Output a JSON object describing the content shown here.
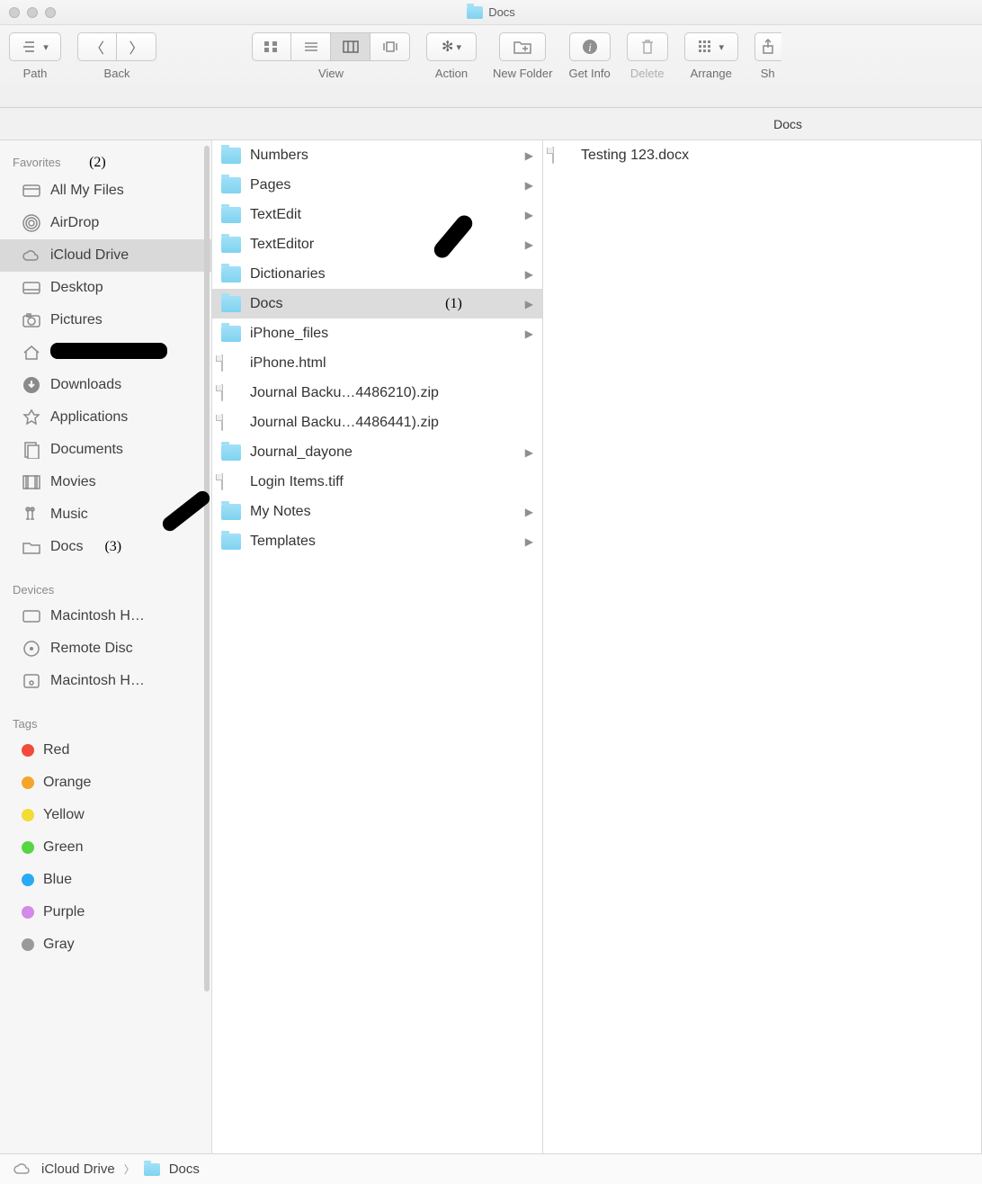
{
  "window": {
    "title": "Docs"
  },
  "toolbar": {
    "path_label": "Path",
    "back_label": "Back",
    "view_label": "View",
    "action_label": "Action",
    "newfolder_label": "New Folder",
    "getinfo_label": "Get Info",
    "delete_label": "Delete",
    "arrange_label": "Arrange",
    "share_label": "Sh"
  },
  "locationbar": {
    "title": "Docs"
  },
  "sidebar": {
    "favorites_heading": "Favorites",
    "devices_heading": "Devices",
    "tags_heading": "Tags",
    "favorites": [
      {
        "label": "All My Files"
      },
      {
        "label": "AirDrop"
      },
      {
        "label": "iCloud Drive",
        "selected": true
      },
      {
        "label": "Desktop"
      },
      {
        "label": "Pictures"
      },
      {
        "label": "",
        "redacted": true
      },
      {
        "label": "Downloads"
      },
      {
        "label": "Applications"
      },
      {
        "label": "Documents"
      },
      {
        "label": "Movies"
      },
      {
        "label": "Music"
      },
      {
        "label": "Docs"
      }
    ],
    "devices": [
      {
        "label": "Macintosh H…"
      },
      {
        "label": "Remote Disc"
      },
      {
        "label": "Macintosh H…"
      }
    ],
    "tags": [
      {
        "label": "Red",
        "color": "#f24b3a"
      },
      {
        "label": "Orange",
        "color": "#f6a52b"
      },
      {
        "label": "Yellow",
        "color": "#f3dc33"
      },
      {
        "label": "Green",
        "color": "#57d544"
      },
      {
        "label": "Blue",
        "color": "#2aa9f5"
      },
      {
        "label": "Purple",
        "color": "#d38ae8"
      },
      {
        "label": "Gray",
        "color": "#9a9a9a"
      }
    ],
    "annotations": {
      "a2": "(2)",
      "a3": "(3)"
    }
  },
  "columns": {
    "col1": [
      {
        "label": "Numbers",
        "type": "appfolder",
        "chev": true
      },
      {
        "label": "Pages",
        "type": "appfolder",
        "chev": true
      },
      {
        "label": "TextEdit",
        "type": "appfolder",
        "chev": true
      },
      {
        "label": "TextEditor",
        "type": "appfolder",
        "chev": true
      },
      {
        "label": "Dictionaries",
        "type": "folder",
        "chev": true
      },
      {
        "label": "Docs",
        "type": "folder",
        "chev": true,
        "selected": true,
        "anno": "(1)"
      },
      {
        "label": "iPhone_files",
        "type": "folder",
        "chev": true
      },
      {
        "label": "iPhone.html",
        "type": "doc",
        "chev": false
      },
      {
        "label": "Journal Backu…4486210).zip",
        "type": "doc",
        "chev": false
      },
      {
        "label": "Journal Backu…4486441).zip",
        "type": "doc",
        "chev": false
      },
      {
        "label": "Journal_dayone",
        "type": "folder",
        "chev": true
      },
      {
        "label": "Login Items.tiff",
        "type": "doc",
        "chev": false
      },
      {
        "label": "My Notes",
        "type": "folder",
        "chev": true
      },
      {
        "label": "Templates",
        "type": "folder",
        "chev": true
      }
    ],
    "col2": [
      {
        "label": "Testing 123.docx",
        "type": "doc"
      }
    ]
  },
  "pathbar": {
    "segments": [
      {
        "label": "iCloud Drive",
        "icon": "cloud"
      },
      {
        "label": "Docs",
        "icon": "folder"
      }
    ]
  }
}
